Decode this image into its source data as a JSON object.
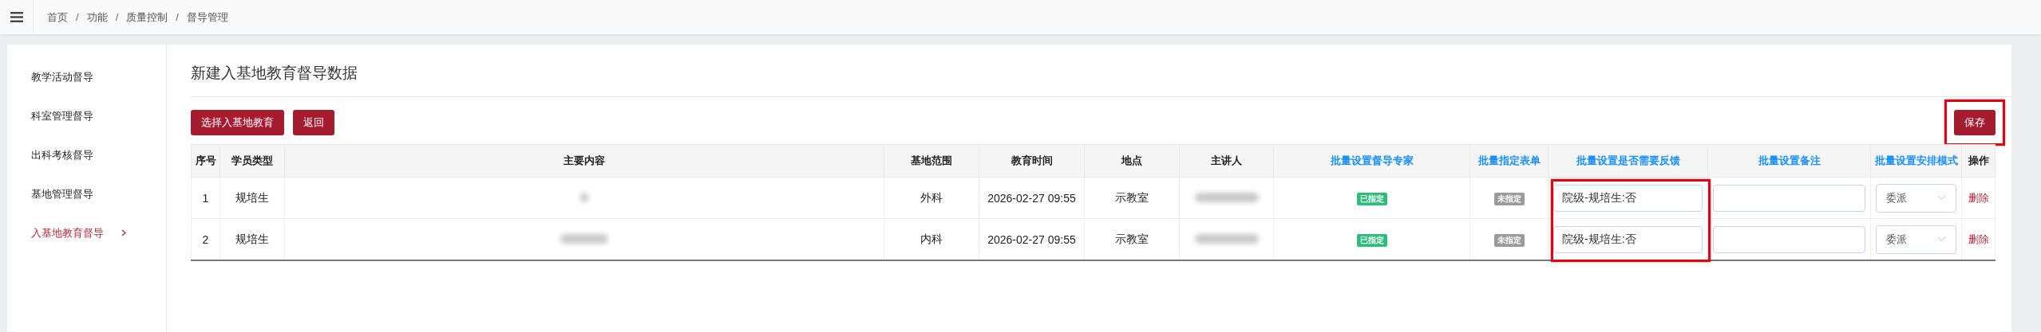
{
  "breadcrumb": [
    "首页",
    "功能",
    "质量控制",
    "督导管理"
  ],
  "breadcrumb_separator": "/",
  "sidebar": {
    "items": [
      {
        "label": "教学活动督导",
        "selected": false
      },
      {
        "label": "科室管理督导",
        "selected": false
      },
      {
        "label": "出科考核督导",
        "selected": false
      },
      {
        "label": "基地管理督导",
        "selected": false
      },
      {
        "label": "入基地教育督导",
        "selected": true
      }
    ]
  },
  "page_title": "新建入基地教育督导数据",
  "toolbar": {
    "buttons": [
      "选择入基地教育",
      "返回"
    ],
    "save_button": {
      "label": "保存",
      "highlighted": true
    }
  },
  "table": {
    "columns": [
      {
        "label": "序号",
        "kind": "text",
        "batch": false,
        "highlighted": false
      },
      {
        "label": "学员类型",
        "kind": "text",
        "batch": false,
        "highlighted": false
      },
      {
        "label": "主要内容",
        "kind": "redacted",
        "batch": false,
        "highlighted": false
      },
      {
        "label": "基地范围",
        "kind": "text",
        "batch": false,
        "highlighted": false
      },
      {
        "label": "教育时间",
        "kind": "text",
        "batch": false,
        "highlighted": false
      },
      {
        "label": "地点",
        "kind": "text",
        "batch": false,
        "highlighted": false
      },
      {
        "label": "主讲人",
        "kind": "redacted",
        "batch": false,
        "highlighted": false
      },
      {
        "label": "批量设置督导专家",
        "kind": "tag",
        "batch": true,
        "highlighted": false
      },
      {
        "label": "批量指定表单",
        "kind": "tag",
        "batch": true,
        "highlighted": false
      },
      {
        "label": "批量设置是否需要反馈",
        "kind": "input",
        "batch": true,
        "highlighted": true
      },
      {
        "label": "批量设置备注",
        "kind": "input",
        "batch": true,
        "highlighted": false
      },
      {
        "label": "批量设置安排模式",
        "kind": "select",
        "batch": true,
        "highlighted": false
      },
      {
        "label": "操作",
        "kind": "link",
        "batch": false,
        "highlighted": false
      }
    ],
    "rows": [
      {
        "cells": [
          {
            "text": "1"
          },
          {
            "text": "规培生"
          },
          {
            "redacted": true
          },
          {
            "text": "外科"
          },
          {
            "text": "2026-02-27 09:55"
          },
          {
            "text": "示教室"
          },
          {
            "redacted": true
          },
          {
            "text": "已指定",
            "assigned": true
          },
          {
            "text": "未指定",
            "assigned": false
          },
          {
            "text": "院级-规培生:否"
          },
          {},
          {
            "text": "委派"
          },
          {
            "text": "删除"
          }
        ]
      },
      {
        "cells": [
          {
            "text": "2"
          },
          {
            "text": "规培生"
          },
          {
            "redacted": true
          },
          {
            "text": "内科"
          },
          {
            "text": "2026-02-27 09:55"
          },
          {
            "text": "示教室"
          },
          {
            "redacted": true
          },
          {
            "text": "已指定",
            "assigned": true
          },
          {
            "text": "未指定",
            "assigned": false
          },
          {
            "text": "院级-规培生:否"
          },
          {},
          {
            "text": "委派"
          },
          {
            "text": "删除"
          }
        ]
      }
    ]
  }
}
